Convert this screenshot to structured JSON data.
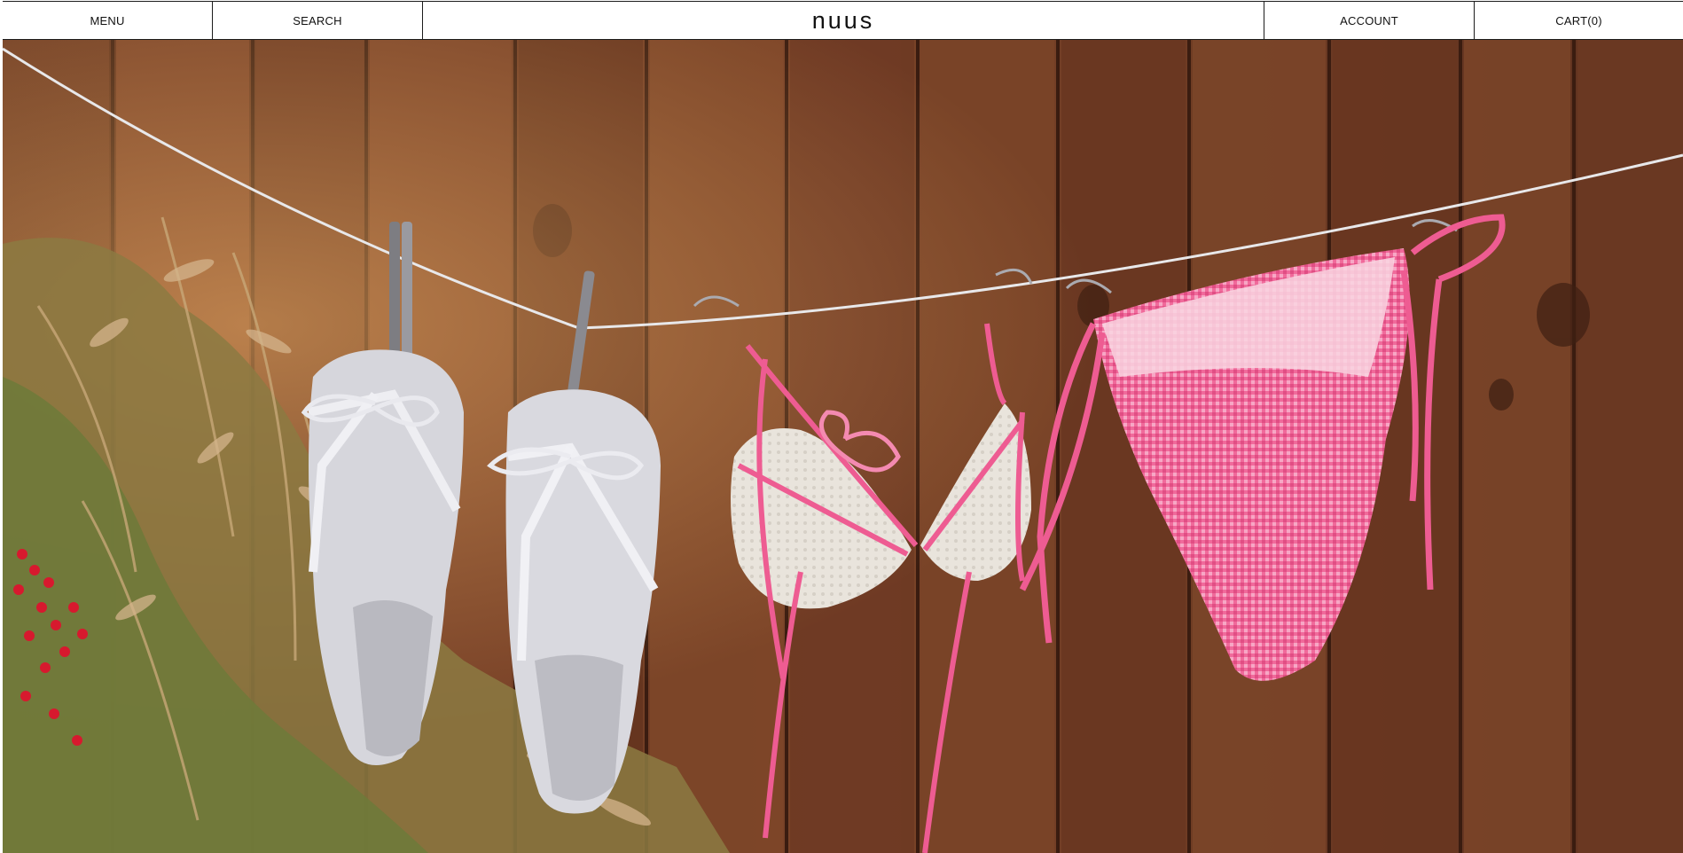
{
  "nav": {
    "menu_label": "MENU",
    "search_label": "SEARCH",
    "logo_text": "nuus",
    "account_label": "ACCOUNT",
    "cart_label": "CART",
    "cart_count": "(0)"
  },
  "hero": {
    "image_description_icon": "photo-clothesline",
    "colors": {
      "fence": "#6b3a22",
      "sandal": "#d9d9de",
      "bikini_pink": "#ee5c92",
      "crochet": "#e7e2da",
      "foliage": "#9a8a4a"
    }
  }
}
